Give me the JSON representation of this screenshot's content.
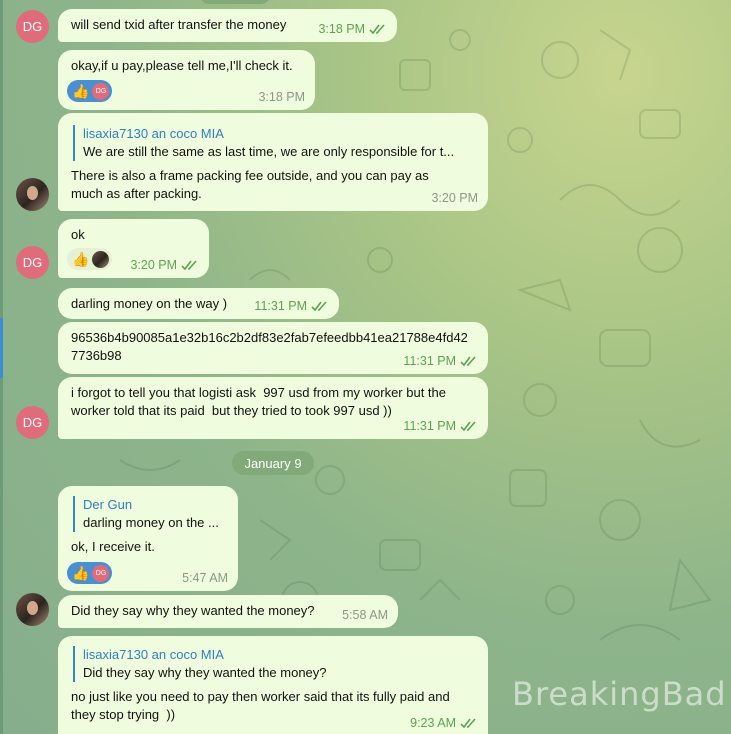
{
  "date_separator": "January 9",
  "watermark": "BreakingBad",
  "avatars": {
    "dg_initials": "DG"
  },
  "reaction_initials": "DG",
  "messages": {
    "m1": {
      "text": "will send txid after transfer the money",
      "time": "3:18 PM",
      "status": "read"
    },
    "m2": {
      "text": "okay,if u pay,please tell me,I'll check it.",
      "time": "3:18 PM",
      "reaction": "👍"
    },
    "m3": {
      "reply_author": "lisaxia7130 an coco MIA",
      "reply_text": "We are still the same as last time, we are only responsible for t...",
      "text": "There is also a frame packing fee outside, and you can pay as much as after packing.",
      "time": "3:20 PM"
    },
    "m4": {
      "text": "ok",
      "time": "3:20 PM",
      "reaction": "👍",
      "status": "read"
    },
    "m5": {
      "text": "darling money on the way )",
      "time": "11:31 PM",
      "status": "read"
    },
    "m6": {
      "text": "96536b4b90085a1e32b16c2b2df83e2fab7efeedbb41ea21788e4fd427736b98",
      "time": "11:31 PM",
      "status": "read"
    },
    "m7": {
      "text": "i forgot to tell you that logisti ask  997 usd from my worker but the worker told that its paid  but they tried to took 997 usd ))",
      "time": "11:31 PM",
      "status": "read"
    },
    "m8": {
      "reply_author": "Der Gun",
      "reply_text": "darling money on the ...",
      "text": "ok, I receive it.",
      "time": "5:47 AM",
      "reaction": "👍"
    },
    "m9": {
      "text": "Did they say why they wanted the money?",
      "time": "5:58 AM"
    },
    "m10": {
      "reply_author": "lisaxia7130 an coco MIA",
      "reply_text": "Did they say why they wanted the money?",
      "text": "no just like you need to pay then worker said that its fully paid and they stop trying  ))",
      "time": "9:23 AM",
      "status": "read"
    }
  },
  "colors": {
    "bubble": "#effdde",
    "time_outgoing": "#5da34f",
    "accent": "#3a86c4",
    "dg_avatar": "#e06b7b"
  }
}
